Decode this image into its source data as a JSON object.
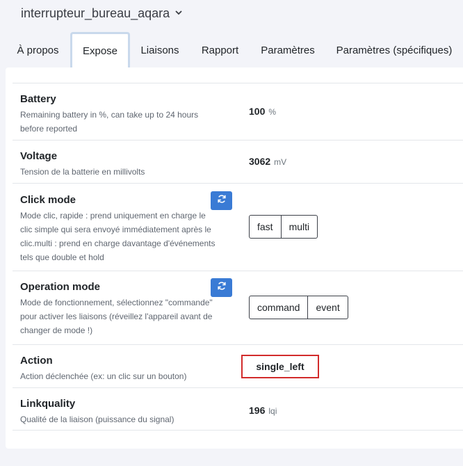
{
  "header": {
    "device_name": "interrupteur_bureau_aqara"
  },
  "tabs": [
    {
      "label": "À propos",
      "active": false
    },
    {
      "label": "Expose",
      "active": true
    },
    {
      "label": "Liaisons",
      "active": false
    },
    {
      "label": "Rapport",
      "active": false
    },
    {
      "label": "Paramètres",
      "active": false
    },
    {
      "label": "Paramètres (spécifiques)",
      "active": false
    }
  ],
  "features": {
    "battery": {
      "name": "Battery",
      "desc1": "Remaining battery in %, can take up to 24 hours",
      "desc2": "before reported",
      "value": "100",
      "unit": "%"
    },
    "voltage": {
      "name": "Voltage",
      "desc1": "Tension de la batterie en millivolts",
      "value": "3062",
      "unit": "mV"
    },
    "click_mode": {
      "name": "Click mode",
      "desc1": "Mode clic, rapide : prend uniquement en charge le",
      "desc2": "clic simple qui sera envoyé immédiatement après le",
      "desc3": "clic.multi : prend en charge davantage d'événements",
      "desc4": "tels que double et hold",
      "options": [
        "fast",
        "multi"
      ]
    },
    "operation_mode": {
      "name": "Operation mode",
      "desc1": "Mode de fonctionnement, sélectionnez \"commande\"",
      "desc2": "pour activer les liaisons (réveillez l'appareil avant de",
      "desc3": "changer de mode !)",
      "options": [
        "command",
        "event"
      ]
    },
    "action": {
      "name": "Action",
      "desc1": "Action déclenchée (ex: un clic sur un bouton)",
      "value": "single_left"
    },
    "linkquality": {
      "name": "Linkquality",
      "desc1": "Qualité de la liaison (puissance du signal)",
      "value": "196",
      "unit": "lqi"
    }
  },
  "icons": {
    "refresh": "refresh-icon",
    "chevron": "chevron-down-icon"
  },
  "colors": {
    "accent": "#3a7bd5",
    "highlight_border": "#d22b2b",
    "active_tab_border": "#c9d9ec"
  }
}
